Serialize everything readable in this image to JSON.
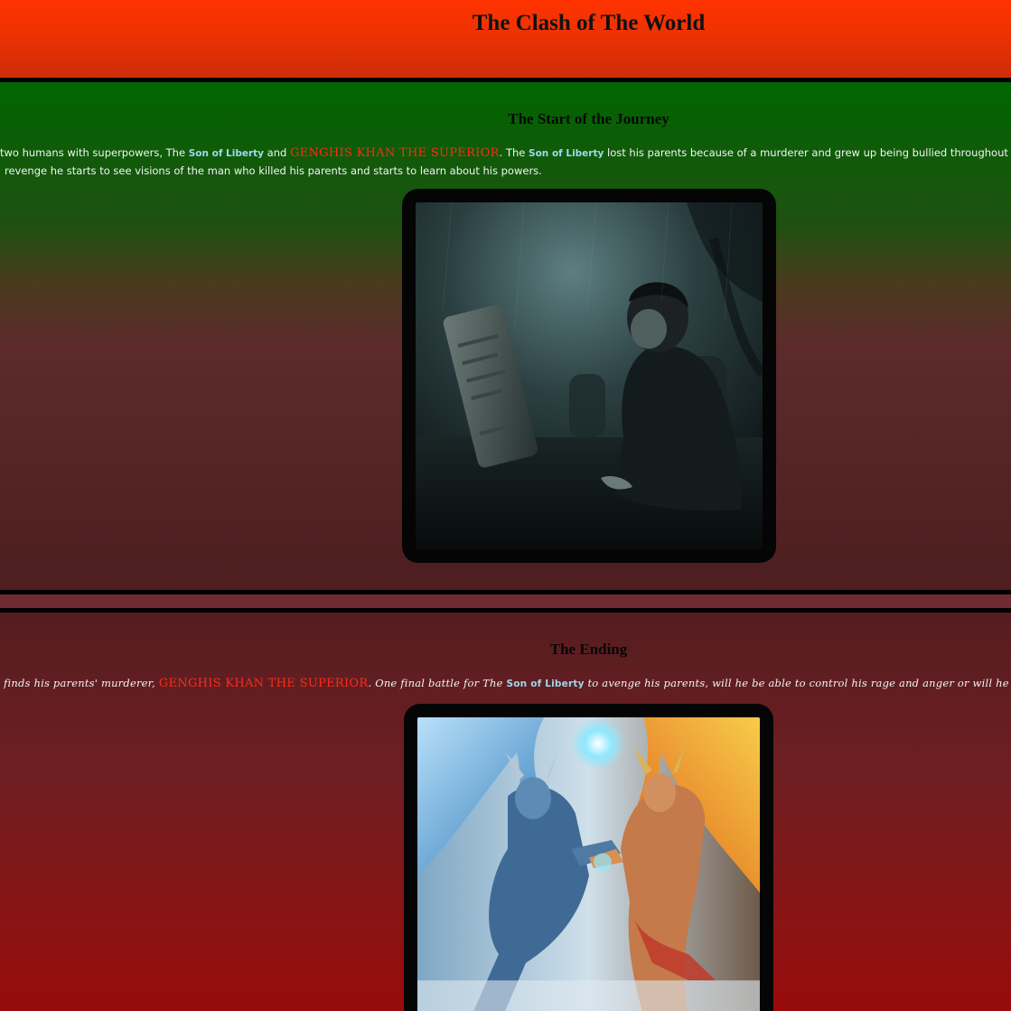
{
  "header": {
    "title": "The Clash of The World"
  },
  "section1": {
    "title": "The Start of the Journey",
    "line1": {
      "p1": "two humans with superpowers, The ",
      "name1": "Son of Liberty",
      "p2": " and ",
      "name2": "GENGHIS KHAN THE SUPERIOR",
      "p3": ". The ",
      "name3": "Son of Liberty",
      "p4": " lost his parents because of a murderer and grew up being bullied throughout his school years. He now s"
    },
    "line2": "revenge he starts to see visions of the man who killed his parents and starts to learn about his powers.",
    "image_alt": "Boy kneeling by a gravestone in a dark, rainy graveyard"
  },
  "section2": {
    "title": "The Ending",
    "line1": {
      "p1": "finds his parents' murderer, ",
      "name1": "GENGHIS KHAN THE SUPERIOR",
      "p2": ". One final battle for The ",
      "name2": "Son of Liberty",
      "p3": " to avenge his parents, will he be able to control his rage and anger or will he be overcome"
    },
    "image_alt": "Two winged horned warriors, one icy blue and one fiery orange, clashing in battle"
  },
  "colors": {
    "header_top": "#ff3300",
    "section1_top": "#006600",
    "section_bottom": "#980b0b",
    "liberty": "#9ed8ee",
    "genghis": "#ff2a1a"
  }
}
